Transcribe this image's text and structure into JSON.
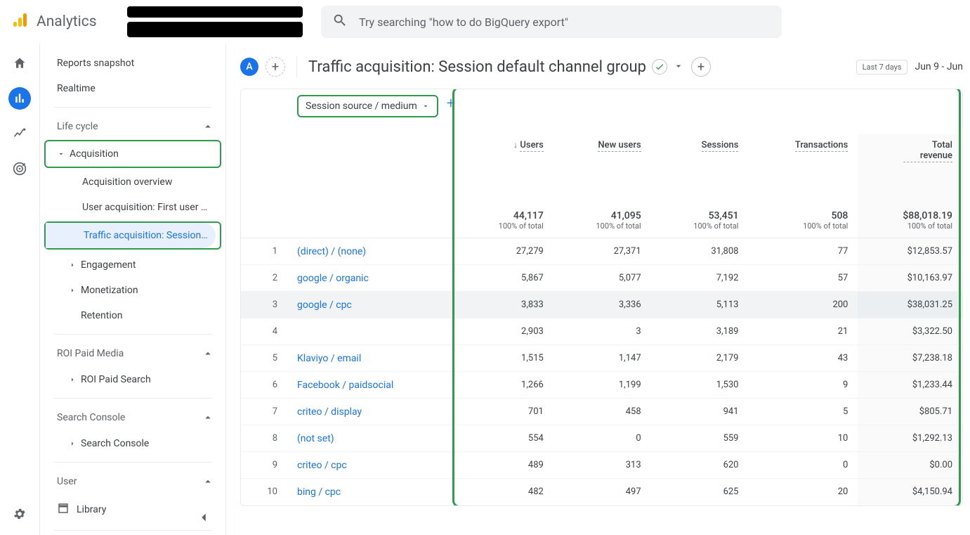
{
  "header": {
    "product": "Analytics",
    "search_placeholder": "Try searching \"how to do BigQuery export\""
  },
  "sidebar": {
    "top": [
      "Reports snapshot",
      "Realtime"
    ],
    "lifecycle": {
      "label": "Life cycle",
      "acquisition": {
        "label": "Acquisition",
        "children": [
          "Acquisition overview",
          "User acquisition: First user …",
          "Traffic acquisition: Session…"
        ]
      },
      "engagement": "Engagement",
      "monetization": "Monetization",
      "retention": "Retention"
    },
    "roi": {
      "label": "ROI Paid Media",
      "child": "ROI Paid Search"
    },
    "sc": {
      "label": "Search Console",
      "child": "Search Console"
    },
    "user": {
      "label": "User",
      "library": "Library"
    }
  },
  "page": {
    "badge": "A",
    "title": "Traffic acquisition: Session default channel group",
    "chip": "Last 7 days",
    "date": "Jun 9 - Jun",
    "dimension": "Session source / medium",
    "plus": "+"
  },
  "columns": [
    "Users",
    "New users",
    "Sessions",
    "Transactions",
    "Total revenue"
  ],
  "totals": {
    "values": [
      "44,117",
      "41,095",
      "53,451",
      "508",
      "$88,018.19"
    ],
    "sub": "100% of total"
  },
  "rows": [
    {
      "idx": "1",
      "dim": "(direct) / (none)",
      "c": [
        "27,279",
        "27,371",
        "31,808",
        "77",
        "$12,853.57"
      ]
    },
    {
      "idx": "2",
      "dim": "google / organic",
      "c": [
        "5,867",
        "5,077",
        "7,192",
        "57",
        "$10,163.97"
      ]
    },
    {
      "idx": "3",
      "dim": "google / cpc",
      "c": [
        "3,833",
        "3,336",
        "5,113",
        "200",
        "$38,031.25"
      ],
      "hl": true
    },
    {
      "idx": "4",
      "dim": "",
      "c": [
        "2,903",
        "3",
        "3,189",
        "21",
        "$3,322.50"
      ]
    },
    {
      "idx": "5",
      "dim": "Klaviyo / email",
      "c": [
        "1,515",
        "1,147",
        "2,179",
        "43",
        "$7,238.18"
      ]
    },
    {
      "idx": "6",
      "dim": "Facebook / paidsocial",
      "c": [
        "1,266",
        "1,199",
        "1,530",
        "9",
        "$1,233.44"
      ]
    },
    {
      "idx": "7",
      "dim": "criteo / display",
      "c": [
        "701",
        "458",
        "941",
        "5",
        "$805.71"
      ]
    },
    {
      "idx": "8",
      "dim": "(not set)",
      "c": [
        "554",
        "0",
        "559",
        "10",
        "$1,292.13"
      ]
    },
    {
      "idx": "9",
      "dim": "criteo / cpc",
      "c": [
        "489",
        "313",
        "620",
        "0",
        "$0.00"
      ]
    },
    {
      "idx": "10",
      "dim": "bing / cpc",
      "c": [
        "482",
        "497",
        "625",
        "20",
        "$4,150.94"
      ]
    }
  ]
}
